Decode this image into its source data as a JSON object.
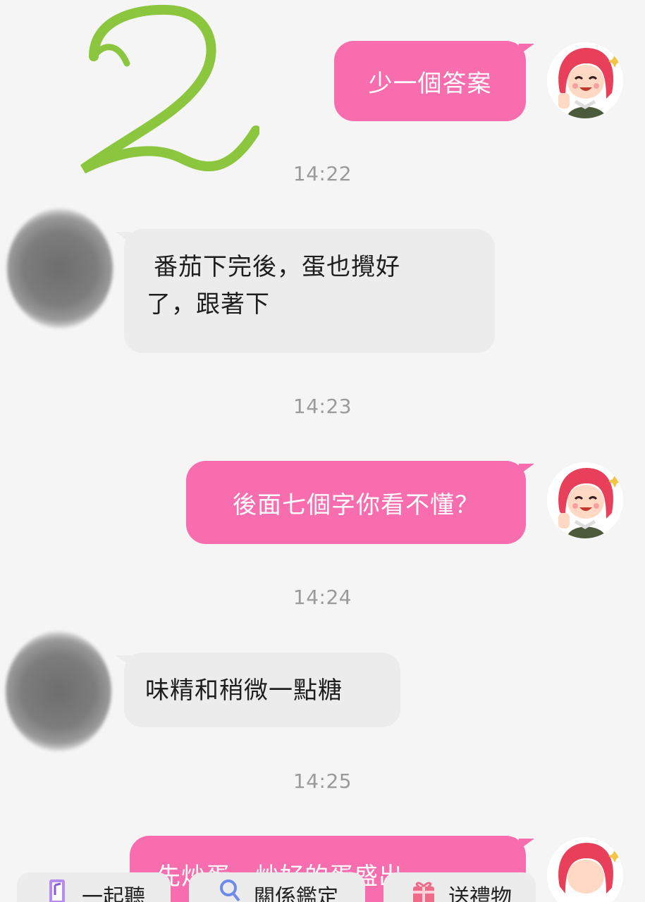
{
  "big_number": "2",
  "messages": [
    {
      "side": "me",
      "text": "少一個答案"
    },
    {
      "type": "time",
      "text": "14:22"
    },
    {
      "side": "other",
      "line1": "番茄下完後，蛋也攪好",
      "line2": "了，跟著下"
    },
    {
      "type": "time",
      "text": "14:23"
    },
    {
      "side": "me",
      "text": "後面七個字你看不懂？"
    },
    {
      "type": "time",
      "text": "14:24"
    },
    {
      "side": "other",
      "text": "味精和稍微一點糖"
    },
    {
      "type": "time",
      "text": "14:25"
    },
    {
      "side": "me",
      "text": "先炒蛋，炒好的蛋盛出"
    }
  ],
  "actions": [
    {
      "label": "一起聽",
      "icon": "music-note-icon"
    },
    {
      "label": "關係鑑定",
      "icon": "magnifier-icon"
    },
    {
      "label": "送禮物",
      "icon": "gift-icon"
    }
  ],
  "colors": {
    "my_bubble": "#f76dae",
    "their_bubble": "#ececec",
    "background": "#f5f5f5",
    "big_number": "#8cc63f",
    "timestamp": "#9a9a9a"
  }
}
